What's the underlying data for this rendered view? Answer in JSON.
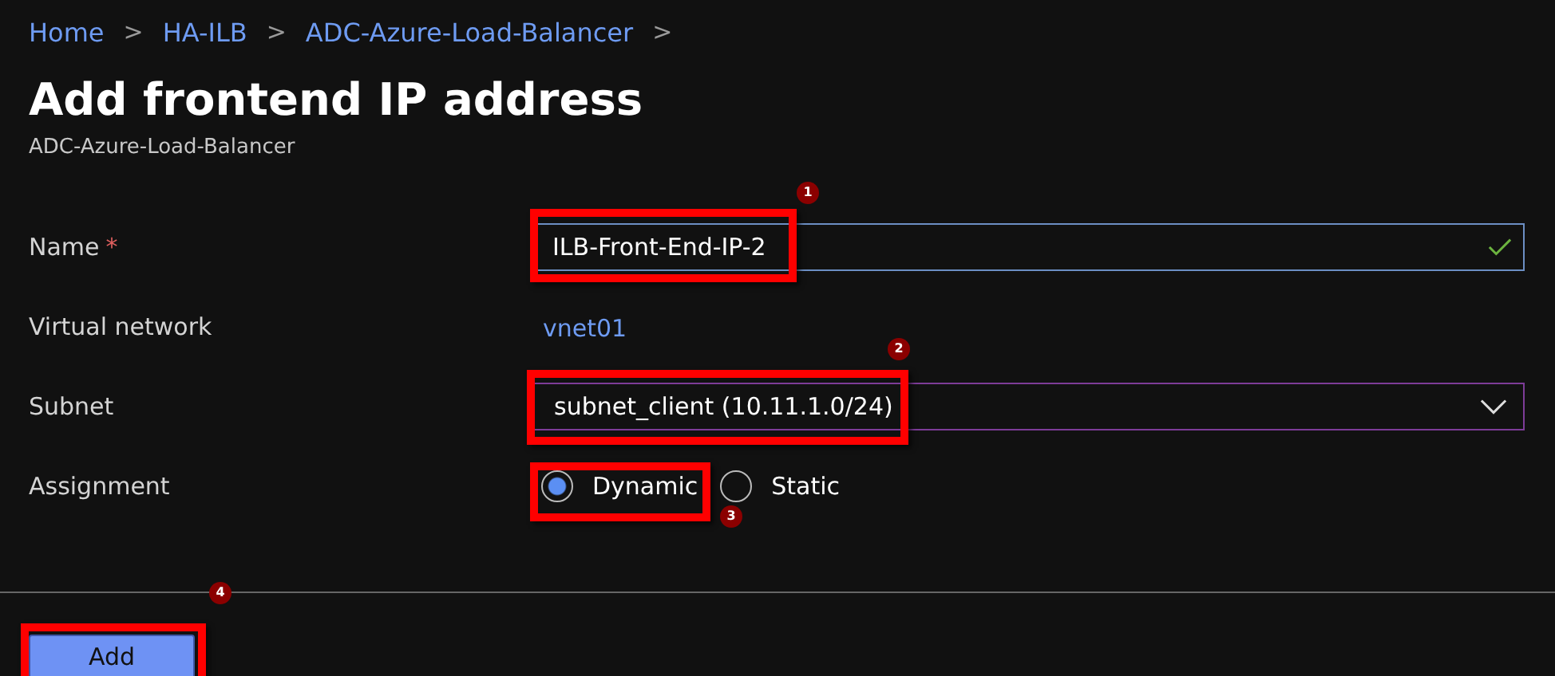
{
  "breadcrumb": [
    {
      "label": "Home"
    },
    {
      "label": "HA-ILB"
    },
    {
      "label": "ADC-Azure-Load-Balancer"
    }
  ],
  "breadcrumb_separator": ">",
  "title": "Add frontend IP address",
  "subtitle": "ADC-Azure-Load-Balancer",
  "fields": [
    {
      "kind": "text",
      "label": "Name",
      "required": true,
      "required_mark": "*",
      "value": "ILB-Front-End-IP-2",
      "valid": true,
      "callout": "1"
    },
    {
      "kind": "link",
      "label": "Virtual network",
      "value": "vnet01"
    },
    {
      "kind": "dropdown",
      "label": "Subnet",
      "value": "subnet_client (10.11.1.0/24)",
      "callout": "2"
    },
    {
      "kind": "radio",
      "label": "Assignment",
      "options": [
        {
          "label": "Dynamic",
          "selected": true
        },
        {
          "label": "Static",
          "selected": false
        }
      ],
      "callout": "3"
    }
  ],
  "add_button": {
    "label": "Add",
    "callout": "4"
  }
}
